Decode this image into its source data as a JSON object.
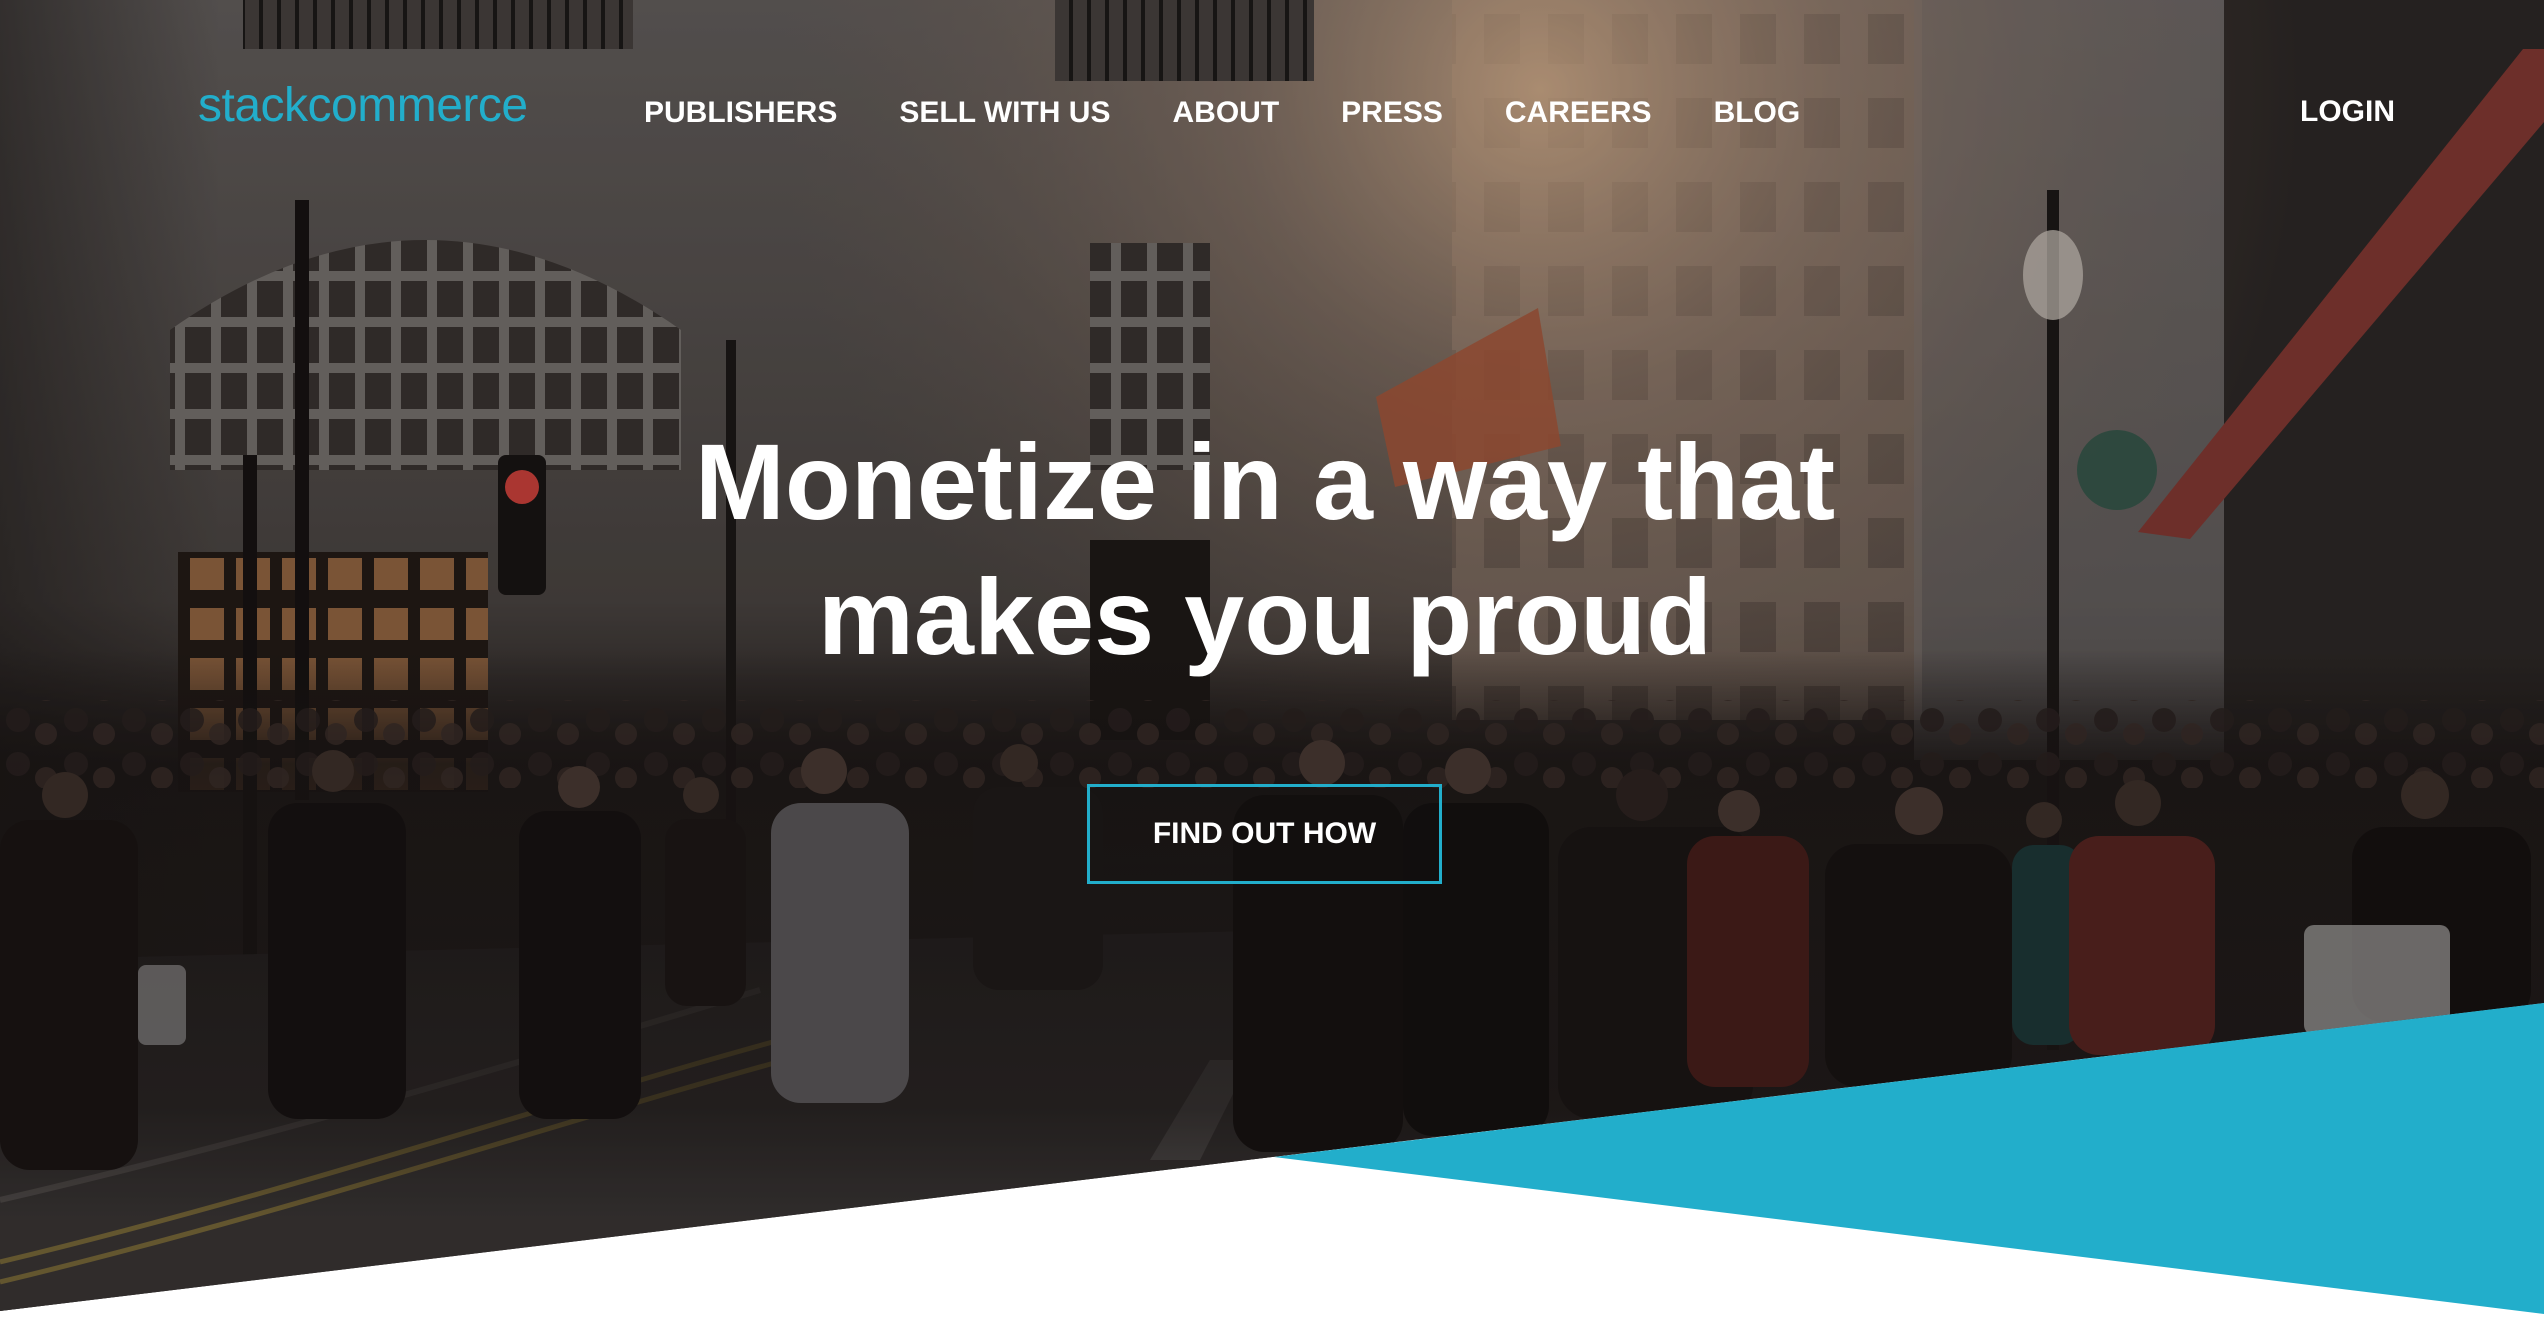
{
  "brand": {
    "logo_text": "stackcommerce"
  },
  "nav": {
    "items": [
      {
        "label": "PUBLISHERS"
      },
      {
        "label": "SELL WITH US"
      },
      {
        "label": "ABOUT"
      },
      {
        "label": "PRESS"
      },
      {
        "label": "CAREERS"
      },
      {
        "label": "BLOG"
      }
    ],
    "login_label": "LOGIN"
  },
  "hero": {
    "headline_line1": "Monetize in a way that",
    "headline_line2": "makes you proud",
    "cta_label": "FIND OUT HOW"
  },
  "colors": {
    "accent": "#22aecb",
    "nav_text": "#ffffff",
    "headline_text": "#ffffff",
    "page_background": "#ffffff"
  }
}
